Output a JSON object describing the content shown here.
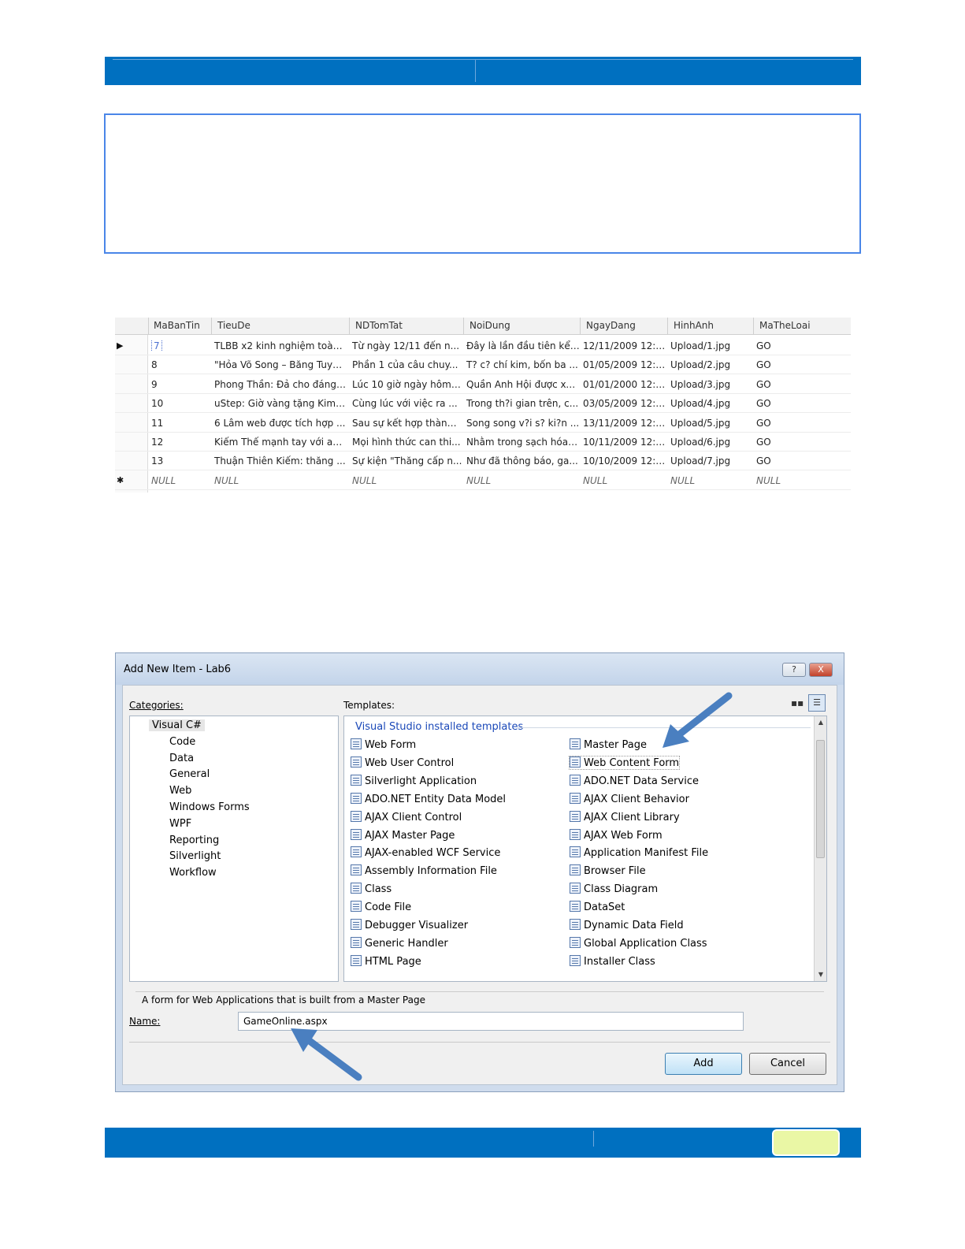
{
  "grid": {
    "columns": [
      "MaBanTin",
      "TieuDe",
      "NDTomTat",
      "NoiDung",
      "NgayDang",
      "HinhAnh",
      "MaTheLoai"
    ],
    "rows": [
      {
        "marker": "▶",
        "cells": [
          "7",
          "TLBB x2 kinh nghiệm toàn ...",
          "Từ ngày 12/11 đến n...",
          "Đây là lần đầu tiên kể t...",
          "12/11/2009 12:0...",
          "Upload/1.jpg",
          "GO"
        ]
      },
      {
        "marker": "",
        "cells": [
          "8",
          "\"Hỏa Võ Song – Băng Tuyế...",
          "Phần 1 của câu chuy...",
          "T? c? chí kim, bốn ba ...",
          "01/05/2009 12:0...",
          "Upload/2.jpg",
          "GO"
        ]
      },
      {
        "marker": "",
        "cells": [
          "9",
          "Phong Thần: Đả cho đáng ...",
          "Lúc 10 giờ ngày hôm ...",
          "Quần Anh Hội được xe...",
          "01/01/2000 12:0...",
          "Upload/3.jpg",
          "GO"
        ]
      },
      {
        "marker": "",
        "cells": [
          "10",
          "uStep: Giờ vàng tặng Kim ...",
          "Cùng lúc với việc ra ...",
          "Trong th?i gian trên, c...",
          "03/05/2009 12:0...",
          "Upload/4.jpg",
          "GO"
        ]
      },
      {
        "marker": "",
        "cells": [
          "11",
          "6 Lâm web được tích hợp ...",
          "Sau sự kết hợp thành ...",
          "Song song v?i s? ki?n ...",
          "13/11/2009 12:0...",
          "Upload/5.jpg",
          "GO"
        ]
      },
      {
        "marker": "",
        "cells": [
          "12",
          "Kiếm Thế mạnh tay với aut...",
          "Mọi hình thức can thi...",
          "Nhằm trong sạch hóa ...",
          "10/11/2009 12:0...",
          "Upload/6.jpg",
          "GO"
        ]
      },
      {
        "marker": "",
        "cells": [
          "13",
          "Thuận Thiên Kiếm: thăng ...",
          "Sự kiện \"Thăng cấp n...",
          "Như đã thông báo, ga...",
          "10/10/2009 12:0...",
          "Upload/7.jpg",
          "GO"
        ]
      },
      {
        "marker": "✱",
        "null_row": true,
        "cells": [
          "NULL",
          "NULL",
          "NULL",
          "NULL",
          "NULL",
          "NULL",
          "NULL"
        ]
      }
    ]
  },
  "dialog": {
    "title": "Add New Item - Lab6",
    "help_label": "?",
    "close_label": "X",
    "categories_label": "Categories:",
    "templates_label": "Templates:",
    "categories": [
      "Visual C#",
      "Code",
      "Data",
      "General",
      "Web",
      "Windows Forms",
      "WPF",
      "Reporting",
      "Silverlight",
      "Workflow"
    ],
    "template_group": "Visual Studio installed templates",
    "templates_left": [
      "Web Form",
      "Web User Control",
      "Silverlight Application",
      "ADO.NET Entity Data Model",
      "AJAX Client Control",
      "AJAX Master Page",
      "AJAX-enabled WCF Service",
      "Assembly Information File",
      "Class",
      "Code File",
      "Debugger Visualizer",
      "Generic Handler",
      "HTML Page"
    ],
    "templates_right": [
      "Master Page",
      "Web Content Form",
      "ADO.NET Data Service",
      "AJAX Client Behavior",
      "AJAX Client Library",
      "AJAX Web Form",
      "Application Manifest File",
      "Browser File",
      "Class Diagram",
      "DataSet",
      "Dynamic Data Field",
      "Global Application Class",
      "Installer Class"
    ],
    "selected_template": "Web Content Form",
    "description": "A form for Web Applications that is built from a Master Page",
    "name_label": "Name:",
    "name_value": "GameOnline.aspx",
    "add_label": "Add",
    "cancel_label": "Cancel"
  },
  "colors": {
    "band": "#0070c0",
    "badge": "#eaf7a5",
    "arrow": "#4a7fc0"
  }
}
